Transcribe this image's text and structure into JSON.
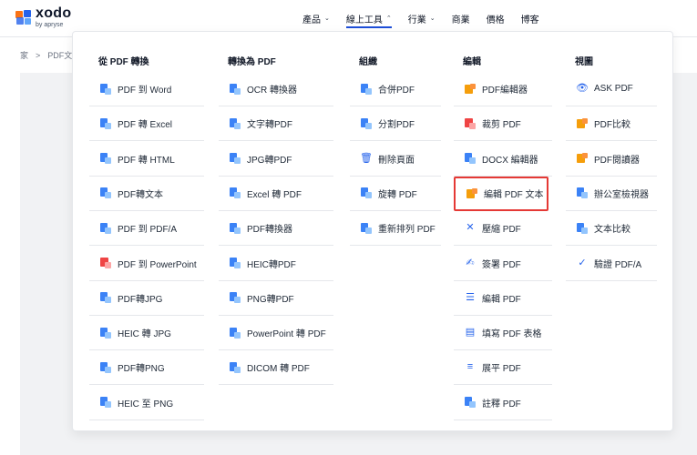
{
  "brand": {
    "name": "xodo",
    "sub": "by apryse"
  },
  "nav": [
    {
      "label": "產品",
      "chevron": "⌄",
      "active": false
    },
    {
      "label": "線上工具",
      "chevron": "⌃",
      "active": true
    },
    {
      "label": "行業",
      "chevron": "⌄",
      "active": false
    },
    {
      "label": "商業",
      "chevron": "",
      "active": false
    },
    {
      "label": "價格",
      "chevron": "",
      "active": false
    },
    {
      "label": "博客",
      "chevron": "",
      "active": false
    }
  ],
  "breadcrumb": {
    "home": "家",
    "sep": ">",
    "current": "PDF文字"
  },
  "columns": [
    {
      "title": "從 PDF 轉換",
      "items": [
        {
          "label": "PDF 到 Word",
          "icon": "doc-icon"
        },
        {
          "label": "PDF 轉 Excel",
          "icon": "doc-icon"
        },
        {
          "label": "PDF 轉 HTML",
          "icon": "doc-icon"
        },
        {
          "label": "PDF轉文本",
          "icon": "doc-icon"
        },
        {
          "label": "PDF 到 PDF/A",
          "icon": "doc-icon"
        },
        {
          "label": "PDF 到 PowerPoint",
          "icon": "doc-red-icon"
        },
        {
          "label": "PDF轉JPG",
          "icon": "doc-icon"
        },
        {
          "label": "HEIC 轉 JPG",
          "icon": "doc-icon"
        },
        {
          "label": "PDF轉PNG",
          "icon": "doc-icon"
        },
        {
          "label": "HEIC 至 PNG",
          "icon": "doc-icon"
        }
      ]
    },
    {
      "title": "轉換為 PDF",
      "items": [
        {
          "label": "OCR 轉換器",
          "icon": "doc-icon"
        },
        {
          "label": "文字轉PDF",
          "icon": "doc-icon"
        },
        {
          "label": "JPG轉PDF",
          "icon": "doc-icon"
        },
        {
          "label": "Excel 轉 PDF",
          "icon": "doc-icon"
        },
        {
          "label": "PDF轉換器",
          "icon": "grid-icon"
        },
        {
          "label": "HEIC轉PDF",
          "icon": "doc-icon"
        },
        {
          "label": "PNG轉PDF",
          "icon": "doc-icon"
        },
        {
          "label": "PowerPoint 轉 PDF",
          "icon": "doc-icon"
        },
        {
          "label": "DICOM 轉 PDF",
          "icon": "doc-icon"
        }
      ]
    },
    {
      "title": "組織",
      "items": [
        {
          "label": "合併PDF",
          "icon": "doc-icon"
        },
        {
          "label": "分割PDF",
          "icon": "doc-icon"
        },
        {
          "label": "刪除頁面",
          "icon": "trash-icon"
        },
        {
          "label": "旋轉 PDF",
          "icon": "doc-icon"
        },
        {
          "label": "重新排列 PDF",
          "icon": "doc-icon"
        }
      ]
    },
    {
      "title": "編輯",
      "items": [
        {
          "label": "PDF編輯器",
          "icon": "pencil-icon"
        },
        {
          "label": "裁剪 PDF",
          "icon": "crop-icon"
        },
        {
          "label": "DOCX 編輯器",
          "icon": "doc-icon"
        },
        {
          "label": "編輯 PDF 文本",
          "icon": "text-edit-icon",
          "highlight": true
        },
        {
          "label": "壓縮 PDF",
          "icon": "compress-icon"
        },
        {
          "label": "簽署 PDF",
          "icon": "signature-icon"
        },
        {
          "label": "編輯 PDF",
          "icon": "list-icon"
        },
        {
          "label": "填寫 PDF 表格",
          "icon": "form-icon"
        },
        {
          "label": "展平 PDF",
          "icon": "layers-icon"
        },
        {
          "label": "註釋 PDF",
          "icon": "doc-icon"
        }
      ]
    },
    {
      "title": "視圖",
      "items": [
        {
          "label": "ASK PDF",
          "icon": "eye-icon"
        },
        {
          "label": "PDF比較",
          "icon": "compare-icon"
        },
        {
          "label": "PDF閱讀器",
          "icon": "reader-icon"
        },
        {
          "label": "辦公室檢視器",
          "icon": "doc-icon"
        },
        {
          "label": "文本比較",
          "icon": "doc-icon"
        },
        {
          "label": "驗證 PDF/A",
          "icon": "verify-icon"
        }
      ]
    }
  ]
}
